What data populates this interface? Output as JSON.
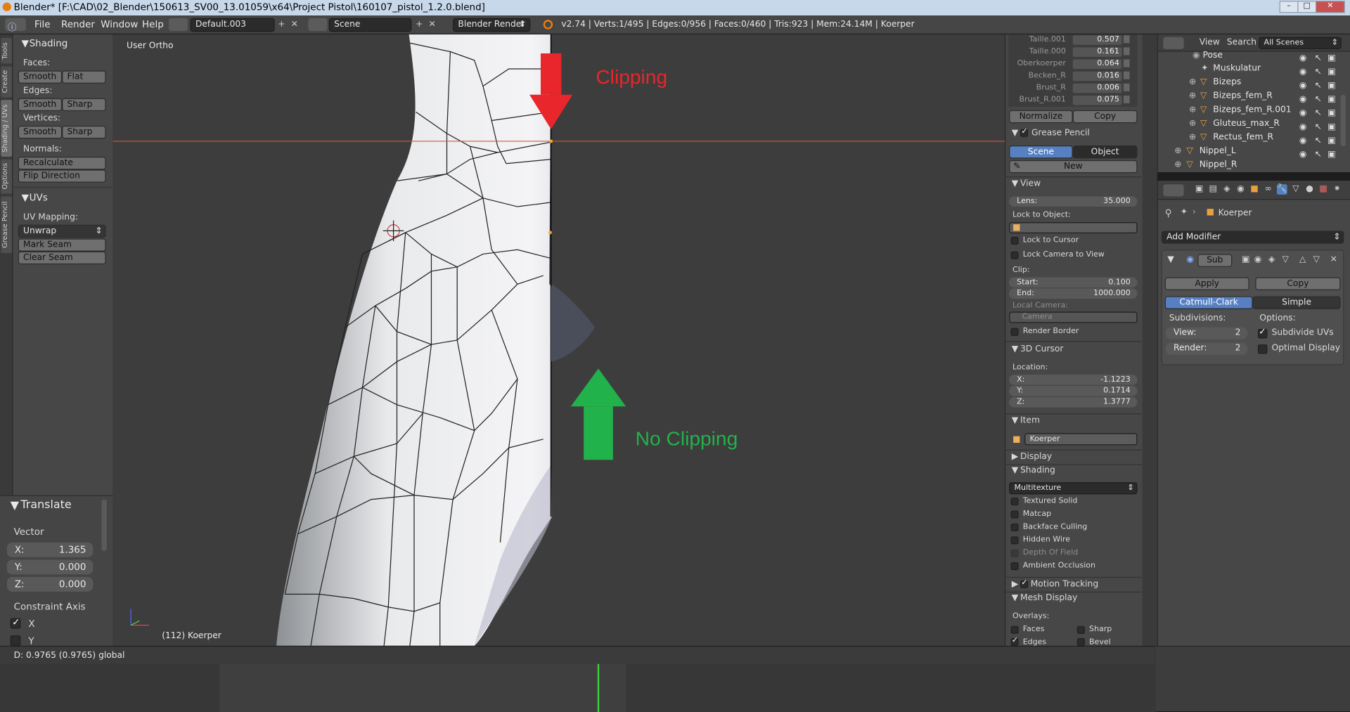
{
  "window": {
    "title": "Blender* [F:\\CAD\\02_Blender\\150613_SV00_13.01059\\x64\\Project Pistol\\160107_pistol_1.2.0.blend]"
  },
  "menubar": {
    "menus": [
      "File",
      "Render",
      "Window",
      "Help"
    ],
    "layout": "Default.003",
    "scene": "Scene",
    "engine": "Blender Render",
    "stats": "v2.74 | Verts:1/495 | Edges:0/956 | Faces:0/460 | Tris:923 | Mem:24.14M | Koerper"
  },
  "tabs": [
    "Tools",
    "Create",
    "Shading / UVs",
    "Options",
    "Grease Pencil"
  ],
  "shading_panel": {
    "title": "Shading",
    "faces_label": "Faces:",
    "smooth": "Smooth",
    "flat": "Flat",
    "edges_label": "Edges:",
    "sharp": "Sharp",
    "vertices_label": "Vertices:",
    "normals_label": "Normals:",
    "recalculate": "Recalculate",
    "flip_direction": "Flip Direction"
  },
  "uvs_panel": {
    "title": "UVs",
    "mapping_label": "UV Mapping:",
    "unwrap": "Unwrap",
    "mark_seam": "Mark Seam",
    "clear_seam": "Clear Seam"
  },
  "operator_panel": {
    "title": "Translate",
    "vector_label": "Vector",
    "x_label": "X:",
    "x": "1.365",
    "y_label": "Y:",
    "y": "0.000",
    "z_label": "Z:",
    "z": "0.000",
    "constraint_label": "Constraint Axis",
    "cx": "X",
    "cy": "Y"
  },
  "viewport": {
    "view_name": "User Ortho",
    "object_label": "(112) Koerper",
    "annotation_clip": "Clipping",
    "annotation_noclip": "No Clipping",
    "colors": {
      "clip": "#e8262b",
      "noclip": "#22b24c"
    }
  },
  "npanel": {
    "shape_keys": [
      {
        "name": "Taille.001",
        "value": "0.507"
      },
      {
        "name": "Taille.000",
        "value": "0.161"
      },
      {
        "name": "Oberkoerper",
        "value": "0.064"
      },
      {
        "name": "Becken_R",
        "value": "0.016"
      },
      {
        "name": "Brust_R",
        "value": "0.006"
      },
      {
        "name": "Brust_R.001",
        "value": "0.075"
      }
    ],
    "normalize": "Normalize",
    "copy": "Copy",
    "grease_pencil": "Grease Pencil",
    "gp_scene": "Scene",
    "gp_object": "Object",
    "gp_new": "New",
    "view_title": "View",
    "lens_label": "Lens:",
    "lens": "35.000",
    "lock_to_object": "Lock to Object:",
    "lock_to_cursor": "Lock to Cursor",
    "lock_camera": "Lock Camera to View",
    "clip_label": "Clip:",
    "start_label": "Start:",
    "start": "0.100",
    "end_label": "End:",
    "end": "1000.000",
    "local_camera": "Local Camera:",
    "camera": "Camera",
    "render_border": "Render Border",
    "cursor_title": "3D Cursor",
    "location_label": "Location:",
    "cx_label": "X:",
    "cx": "-1.1223",
    "cy_label": "Y:",
    "cy": "0.1714",
    "cz_label": "Z:",
    "cz": "1.3777",
    "item_title": "Item",
    "item_name": "Koerper",
    "display_title": "Display",
    "shading_title": "Shading",
    "shading_mode": "Multitexture",
    "shading_opts": [
      "Textured Solid",
      "Matcap",
      "Backface Culling",
      "Hidden Wire",
      "Depth Of Field",
      "Ambient Occlusion"
    ],
    "motion_tracking": "Motion Tracking",
    "mesh_display": "Mesh Display",
    "overlays_label": "Overlays:",
    "ov_faces": "Faces",
    "ov_sharp": "Sharp",
    "ov_edges": "Edges",
    "ov_bevel": "Bevel"
  },
  "outliner": {
    "view": "View",
    "search": "Search",
    "scenes": "All Scenes",
    "rows": [
      "Pose",
      "Muskulatur",
      "Bizeps",
      "Bizeps_fem_R",
      "Bizeps_fem_R.001",
      "Gluteus_max_R",
      "Rectus_fem_R",
      "Nippel_L",
      "Nippel_R"
    ]
  },
  "properties": {
    "object": "Koerper",
    "add_modifier": "Add Modifier",
    "mod_name": "Sub",
    "apply": "Apply",
    "copy": "Copy",
    "catmull": "Catmull-Clark",
    "simple": "Simple",
    "subdivisions_label": "Subdivisions:",
    "options_label": "Options:",
    "view_label": "View:",
    "view_val": "2",
    "render_label": "Render:",
    "render_val": "2",
    "subdivide_uvs": "Subdivide UVs",
    "optimal_display": "Optimal Display"
  },
  "status": {
    "text": "D: 0.9765 (0.9765) global"
  }
}
